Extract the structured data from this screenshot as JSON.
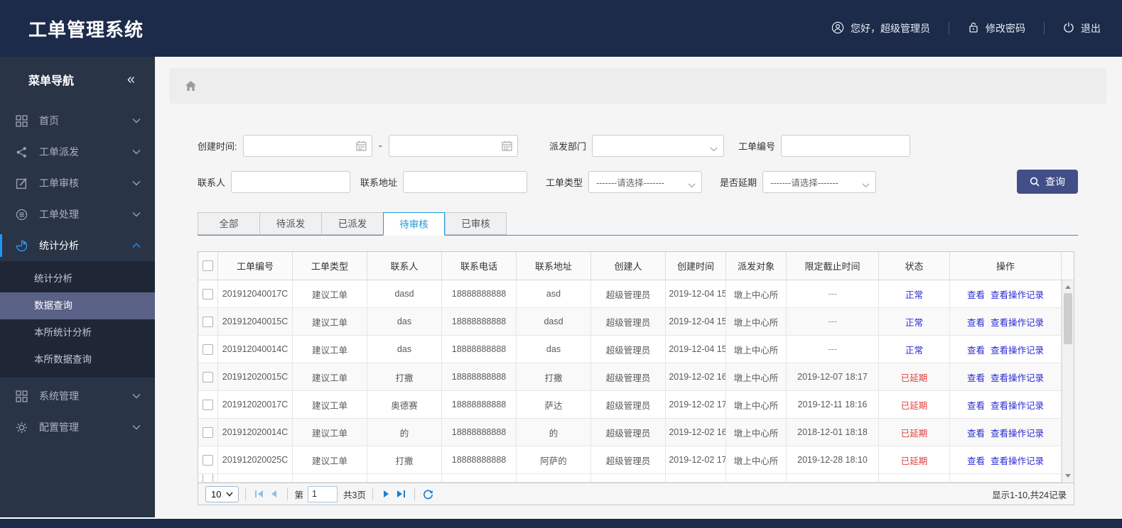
{
  "app": {
    "title": "工单管理系统"
  },
  "header": {
    "greeting": "您好，超级管理员",
    "change_password": "修改密码",
    "logout": "退出"
  },
  "sidebar": {
    "title": "菜单导航",
    "collapse_icon": "«",
    "items": [
      {
        "label": "首页",
        "icon": "grid-icon"
      },
      {
        "label": "工单派发",
        "icon": "share-icon"
      },
      {
        "label": "工单审核",
        "icon": "edit-icon"
      },
      {
        "label": "工单处理",
        "icon": "process-icon"
      },
      {
        "label": "统计分析",
        "icon": "pie-chart-icon",
        "active": true,
        "expanded": true,
        "children": [
          {
            "label": "统计分析",
            "active": false
          },
          {
            "label": "数据查询",
            "active": true
          },
          {
            "label": "本所统计分析",
            "active": false
          },
          {
            "label": "本所数据查询",
            "active": false
          }
        ]
      },
      {
        "label": "系统管理",
        "icon": "grid-icon"
      },
      {
        "label": "配置管理",
        "icon": "gear-icon"
      }
    ]
  },
  "filters": {
    "create_time_label": "创建时间:",
    "date_separator": "-",
    "dispatch_dept_label": "派发部门",
    "order_no_label": "工单编号",
    "contact_label": "联系人",
    "address_label": "联系地址",
    "order_type_label": "工单类型",
    "order_type_value": "-------请选择-------",
    "delay_label": "是否延期",
    "delay_value": "-------请选择-------",
    "search_button": "查询"
  },
  "tabs": [
    {
      "label": "全部",
      "active": false
    },
    {
      "label": "待派发",
      "active": false
    },
    {
      "label": "已派发",
      "active": false
    },
    {
      "label": "待审核",
      "active": true
    },
    {
      "label": "已审核",
      "active": false
    }
  ],
  "table": {
    "columns": [
      "工单编号",
      "工单类型",
      "联系人",
      "联系电话",
      "联系地址",
      "创建人",
      "创建时间",
      "派发对象",
      "限定截止时间",
      "状态",
      "操作"
    ],
    "action_labels": {
      "view": "查看",
      "view_log": "查看操作记录"
    },
    "rows": [
      {
        "order_no": "201912040017C",
        "type": "建议工单",
        "contact": "dasd",
        "phone": "18888888888",
        "address": "asd",
        "creator": "超级管理员",
        "created": "2019-12-04 15",
        "target": "墩上中心所",
        "deadline": "---",
        "status": "正常",
        "status_type": "normal"
      },
      {
        "order_no": "201912040015C",
        "type": "建议工单",
        "contact": "das",
        "phone": "18888888888",
        "address": "dasd",
        "creator": "超级管理员",
        "created": "2019-12-04 15",
        "target": "墩上中心所",
        "deadline": "---",
        "status": "正常",
        "status_type": "normal"
      },
      {
        "order_no": "201912040014C",
        "type": "建议工单",
        "contact": "das",
        "phone": "18888888888",
        "address": "das",
        "creator": "超级管理员",
        "created": "2019-12-04 15",
        "target": "墩上中心所",
        "deadline": "---",
        "status": "正常",
        "status_type": "normal"
      },
      {
        "order_no": "201912020015C",
        "type": "建议工单",
        "contact": "打撒",
        "phone": "18888888888",
        "address": "打撒",
        "creator": "超级管理员",
        "created": "2019-12-02 16",
        "target": "墩上中心所",
        "deadline": "2019-12-07 18:17",
        "status": "已延期",
        "status_type": "delayed"
      },
      {
        "order_no": "201912020017C",
        "type": "建议工单",
        "contact": "奥德赛",
        "phone": "18888888888",
        "address": "萨达",
        "creator": "超级管理员",
        "created": "2019-12-02 17",
        "target": "墩上中心所",
        "deadline": "2019-12-11 18:16",
        "status": "已延期",
        "status_type": "delayed"
      },
      {
        "order_no": "201912020014C",
        "type": "建议工单",
        "contact": "的",
        "phone": "18888888888",
        "address": "的",
        "creator": "超级管理员",
        "created": "2019-12-02 16",
        "target": "墩上中心所",
        "deadline": "2018-12-01 18:18",
        "status": "已延期",
        "status_type": "delayed"
      },
      {
        "order_no": "201912020025C",
        "type": "建议工单",
        "contact": "打撒",
        "phone": "18888888888",
        "address": "阿萨的",
        "creator": "超级管理员",
        "created": "2019-12-02 17",
        "target": "墩上中心所",
        "deadline": "2019-12-28 18:10",
        "status": "已延期",
        "status_type": "delayed"
      }
    ]
  },
  "pagination": {
    "page_size": "10",
    "page_prefix": "第",
    "current_page": "1",
    "total_pages": "共3页",
    "summary": "显示1-10,共24记录"
  },
  "colors": {
    "navy": "#1c2b4a",
    "sidebar": "#2a3447",
    "accent_blue": "#2196f3",
    "tab_blue": "#1d9bd8",
    "link_blue": "#2a2ad6",
    "status_red": "#e03c3c",
    "button_indigo": "#414e87"
  }
}
